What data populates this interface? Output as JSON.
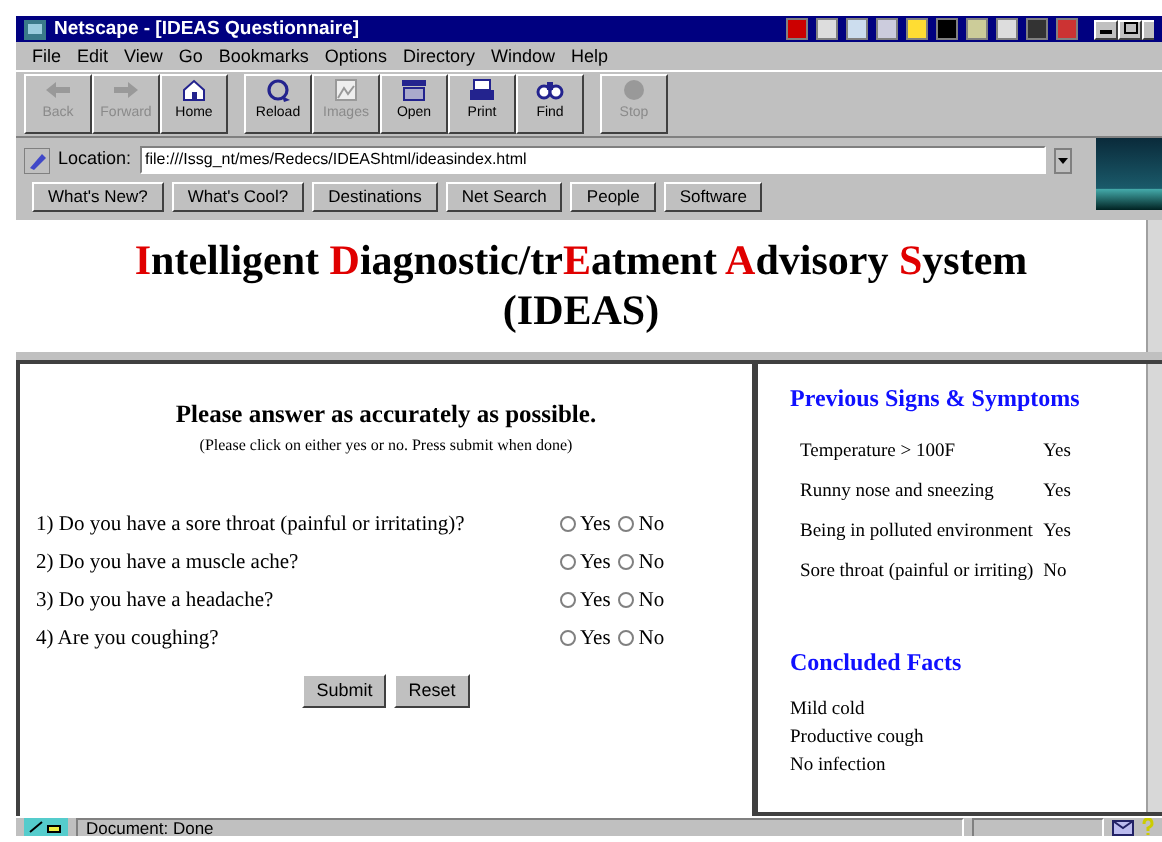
{
  "window": {
    "title": "Netscape - [IDEAS Questionnaire]"
  },
  "menu": [
    {
      "label": "File"
    },
    {
      "label": "Edit"
    },
    {
      "label": "View"
    },
    {
      "label": "Go"
    },
    {
      "label": "Bookmarks"
    },
    {
      "label": "Options"
    },
    {
      "label": "Directory"
    },
    {
      "label": "Window"
    },
    {
      "label": "Help"
    }
  ],
  "toolbar": [
    {
      "kind": "back",
      "label": "Back",
      "disabled": true
    },
    {
      "kind": "forward",
      "label": "Forward",
      "disabled": true
    },
    {
      "kind": "home",
      "label": "Home",
      "disabled": false
    },
    {
      "kind": "reload",
      "label": "Reload",
      "disabled": false
    },
    {
      "kind": "images",
      "label": "Images",
      "disabled": true
    },
    {
      "kind": "open",
      "label": "Open",
      "disabled": false
    },
    {
      "kind": "print",
      "label": "Print",
      "disabled": false
    },
    {
      "kind": "find",
      "label": "Find",
      "disabled": false
    },
    {
      "kind": "stop",
      "label": "Stop",
      "disabled": true
    }
  ],
  "location": {
    "label": "Location:",
    "value": "file:///Issg_nt/mes/Redecs/IDEAShtml/ideasindex.html"
  },
  "directory_buttons": [
    {
      "label": "What's New?"
    },
    {
      "label": "What's Cool?"
    },
    {
      "label": "Destinations"
    },
    {
      "label": "Net Search"
    },
    {
      "label": "People"
    },
    {
      "label": "Software"
    }
  ],
  "page": {
    "title_lines": [
      [
        {
          "text": "I",
          "highlight": true
        },
        {
          "text": "ntelligent ",
          "highlight": false
        },
        {
          "text": "D",
          "highlight": true
        },
        {
          "text": "iagnostic/tr",
          "highlight": false
        },
        {
          "text": "E",
          "highlight": true
        },
        {
          "text": "atment ",
          "highlight": false
        },
        {
          "text": "A",
          "highlight": true
        },
        {
          "text": "dvisory ",
          "highlight": false
        },
        {
          "text": "S",
          "highlight": true
        },
        {
          "text": "ystem",
          "highlight": false
        }
      ],
      [
        {
          "text": "(IDEAS)",
          "highlight": false
        }
      ]
    ],
    "form": {
      "heading": "Please answer as accurately as possible.",
      "instructions": "(Please click on either yes or no. Press submit when done)",
      "questions": [
        {
          "text": "1) Do you have a sore throat (painful or irritating)?",
          "options": [
            {
              "label": "Yes",
              "selected": false
            },
            {
              "label": "No",
              "selected": false
            }
          ]
        },
        {
          "text": "2) Do you have a muscle ache?",
          "options": [
            {
              "label": "Yes",
              "selected": false
            },
            {
              "label": "No",
              "selected": false
            }
          ]
        },
        {
          "text": "3) Do you have a headache?",
          "options": [
            {
              "label": "Yes",
              "selected": false
            },
            {
              "label": "No",
              "selected": false
            }
          ]
        },
        {
          "text": "4) Are you coughing?",
          "options": [
            {
              "label": "Yes",
              "selected": false
            },
            {
              "label": "No",
              "selected": false
            }
          ]
        }
      ],
      "buttons": [
        {
          "label": "Submit"
        },
        {
          "label": "Reset"
        }
      ]
    },
    "sidebar": {
      "signs_heading": "Previous Signs & Symptoms",
      "signs": [
        {
          "sign": "Temperature > 100F",
          "answer": "Yes"
        },
        {
          "sign": "Runny nose and sneezing",
          "answer": "Yes"
        },
        {
          "sign": "Being in polluted environment",
          "answer": "Yes"
        },
        {
          "sign": "Sore throat (painful or irriting)",
          "answer": "No"
        }
      ],
      "facts_heading": "Concluded Facts",
      "facts": [
        "Mild cold",
        "Productive cough",
        "No infection"
      ]
    }
  },
  "status_bar": {
    "text": "Document: Done"
  }
}
